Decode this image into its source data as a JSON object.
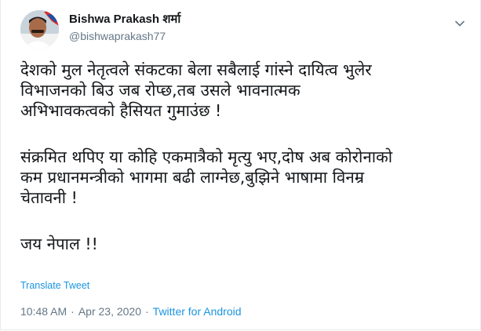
{
  "author": {
    "display_name": "Bishwa Prakash शर्मा",
    "handle": "@bishwaprakash77",
    "avatar_icon": "profile-photo",
    "menu_icon": "chevron-down-icon"
  },
  "tweet": {
    "lines": [
      "देशको मुल नेतृत्वले संकटका बेला सबैलाई गांस्ने दायित्व भुलेर",
      "विभाजनको बिउ जब रोप्छ,तब उसले भावनात्मक",
      "अभिभावकत्वको हैसियत गुमाउंछ !",
      "",
      "संक्रमित थपिए या कोहि एकमात्रैको मृत्यु भए,दोष अब कोरोनाको",
      "कम प्रधानमन्त्रीको भागमा बढी लाग्नेछ,बुझिने भाषामा विनम्र",
      "चेतावनी !",
      "",
      "जय नेपाल !!"
    ]
  },
  "translate_label": "Translate Tweet",
  "meta": {
    "time": "10:48 AM",
    "separator1": "·",
    "date": "Apr 23, 2020",
    "separator2": "·",
    "source": "Twitter for Android"
  },
  "colors": {
    "link": "#1b95e0",
    "muted": "#657786",
    "text": "#14171a"
  }
}
